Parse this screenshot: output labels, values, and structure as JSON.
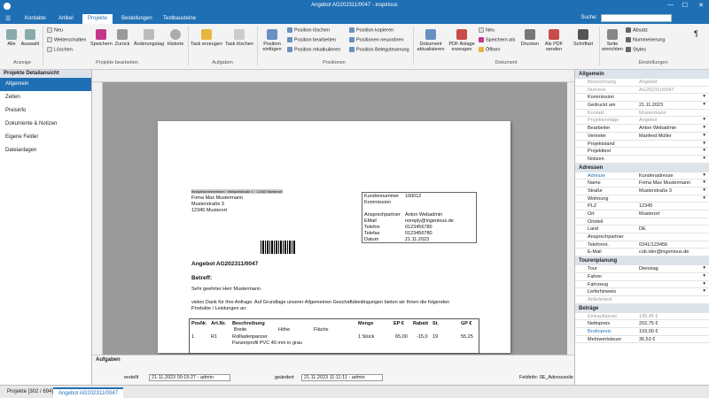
{
  "window": {
    "title": "Angebot AG202311/0047 - inspirious"
  },
  "tabs": [
    {
      "label": "Kontakte"
    },
    {
      "label": "Artikel"
    },
    {
      "label": "Projekte"
    },
    {
      "label": "Bestellungen"
    },
    {
      "label": "Textbausteine"
    }
  ],
  "search": {
    "label": "Suche:"
  },
  "ribbon": {
    "anzeige": {
      "alle": "Alle",
      "auswahl": "Auswahl",
      "group": "Anzeige"
    },
    "proj": {
      "neu": "Neu",
      "weiterschalten": "Weiterschalten",
      "loeschen": "Löschen",
      "speichern": "Speichern",
      "zurueck": "Zurück",
      "aenderungstag": "Änderungstag",
      "historie": "Historie",
      "group": "Projekte bearbeiten"
    },
    "aufg": {
      "erzeugen": "Task erzeugen",
      "loeschen": "Task löschen",
      "group": "Aufgaben"
    },
    "pos": {
      "einfuegen": "Position einfügen",
      "loeschen": "Position löschen",
      "bearbeiten": "Position bearbeiten",
      "rekalk": "Position rekalkulieren",
      "kopieren": "Position kopieren",
      "neuordnen": "Positionen neuordnen",
      "beleg": "Position Belegsteuerung",
      "group": "Positionen"
    },
    "dok": {
      "aktual": "Dokument aktualisieren",
      "pdf": "PDF Anlage erzeugen",
      "neu": "Neu",
      "speichern_als": "Speichern als",
      "oeffnen": "Öffnen",
      "drucken": "Drucken",
      "alspdf": "Als PDF senden",
      "schrift": "Schriftart",
      "group": "Dokument"
    },
    "einst": {
      "seite": "Seite einrichten",
      "absatz": "Absatz",
      "numm": "Nummerierung",
      "styles": "Styles",
      "group": "Einstellungen"
    }
  },
  "leftnav": {
    "header": "Projekte Detailansicht",
    "items": [
      "Allgemein",
      "Zeiten",
      "Preisinfo",
      "Dokumente & Notizen",
      "Eigene Felder",
      "Dateianlagen"
    ]
  },
  "doc": {
    "sender": "Beispielunternehmen · Beispielstraße 1 · 12345 Musterort",
    "addr": [
      "Firma Max Mustermann",
      "Musterstraße 3",
      "12345 Musterort"
    ],
    "kbox": [
      [
        "Kundennummer",
        "100012"
      ],
      [
        "Kommission",
        ""
      ],
      [
        "",
        ""
      ],
      [
        "Ansprechpartner",
        "Anton Webadmin"
      ],
      [
        "EMail",
        "noreply@ingenious.de"
      ],
      [
        "Telefon",
        "0123456780"
      ],
      [
        "Telefax",
        "0123456780"
      ],
      [
        "",
        ""
      ],
      [
        "Datum",
        "21.11.2023"
      ]
    ],
    "title": "Angebot AG202311/0047",
    "betreff": "Betreff:",
    "anrede": "Sehr geehrter Herr Mustermann",
    "intro1": "vielen Dank für Ihre Anfrage. Auf Grundlage unserer Allgemeinen Geschäftsbedingungen bieten wir Ihnen die folgenden",
    "intro2": "Produkte / Leistungen an:",
    "th": {
      "pos": "PosNr.",
      "art": "Art.Nr.",
      "desc": "Beschreibung",
      "menge": "Menge",
      "ep": "EP €",
      "rabatt": "Rabatt",
      "st": "St.",
      "gp": "GP €",
      "breite": "Breite",
      "hoehe": "Höhe",
      "flaeche": "Fläche"
    },
    "row": {
      "pos": "1",
      "art": "R1",
      "desc": "Rollladenpanzer",
      "desc2": "Panzerprofil PVC 40 mm in grau",
      "menge": "1 Stück",
      "ep": "65,00",
      "rabatt": "-15,0",
      "st": "19",
      "gp": "55,25"
    }
  },
  "aufgaben": {
    "title": "Aufgaben",
    "erstellt_lbl": "erstellt",
    "erstellt": "21.11.2023 09:15:27 - admin",
    "geaendert_lbl": "geändert",
    "geaendert": "21.11.2023 11:11:11 - admin",
    "feldinfo": "Feldinfo: 0E_Adresszeile"
  },
  "props": {
    "allgemein": "Allgemein",
    "rows1": [
      [
        "Bezeichnung",
        "Angebot"
      ],
      [
        "Nummer",
        "AG202311/0047"
      ],
      [
        "Kommission",
        ""
      ],
      [
        "Gedruckt am",
        "21.11.2023"
      ],
      [
        "Kontakt",
        "Mustermann"
      ],
      [
        "Projektvorlage",
        "Angebot"
      ],
      [
        "Bearbeiter",
        "Anton Webadmin"
      ],
      [
        "Vertreter",
        "Manfred Müller"
      ],
      [
        "Projektstand",
        ""
      ],
      [
        "Projekttext",
        ""
      ],
      [
        "Notizen",
        ""
      ]
    ],
    "adressen": "Adressen",
    "rows2": [
      [
        "Adresse",
        "Kundenadresse"
      ],
      [
        "Name",
        "Firma Max Mustermann"
      ],
      [
        "Straße",
        "Musterstraße 3"
      ],
      [
        "Wohnung",
        ""
      ],
      [
        "PLZ",
        "12345"
      ],
      [
        "Ort",
        "Musterort"
      ],
      [
        "Ortsteil",
        ""
      ],
      [
        "Land",
        "DE"
      ],
      [
        "Ansprechpartner",
        ""
      ],
      [
        "Telefonnr.",
        "0341/123456"
      ],
      [
        "E-Mail",
        "cob.ider@ingenious.de"
      ]
    ],
    "tourenplanung": "Tourenplanung",
    "rows3": [
      [
        "Tour",
        "Dienstag"
      ],
      [
        "Fahrer",
        ""
      ],
      [
        "Fahrzeug",
        ""
      ],
      [
        "Lieferhinweis",
        ""
      ],
      [
        "Anliefertext",
        ""
      ]
    ],
    "betraege": "Beträge",
    "rows4": [
      [
        "Einkaufspreis",
        "130,45 €"
      ],
      [
        "Nettopreis",
        "202,75 €"
      ],
      [
        "Bruttopreis",
        "193,00 €"
      ],
      [
        "Mehrwertsteuer",
        "36,53 €"
      ]
    ]
  },
  "statusbar": {
    "tabs": [
      "Projekte [302 / 694]",
      "Angebot AG202311/0047"
    ]
  }
}
